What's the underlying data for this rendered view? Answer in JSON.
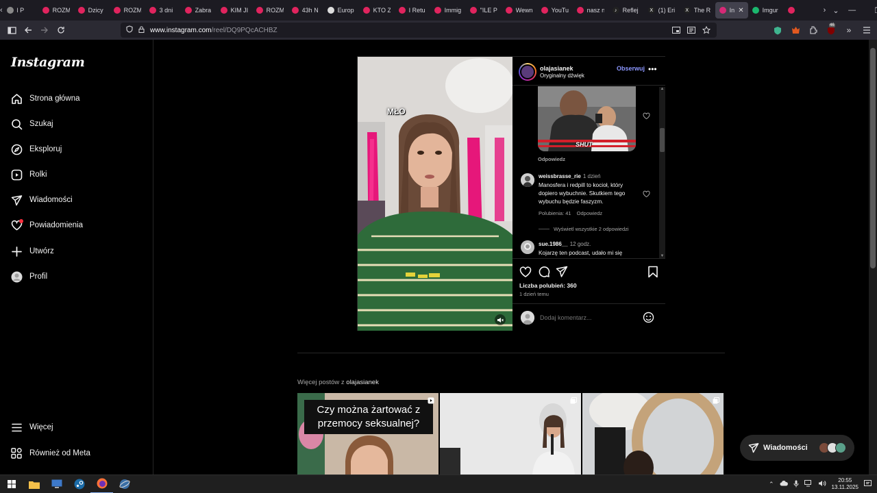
{
  "browser": {
    "tabs": [
      {
        "label": "l P",
        "color": "#888888",
        "glyph": ""
      },
      {
        "label": "ROZM",
        "color": "#e0245e",
        "glyph": ""
      },
      {
        "label": "Dzicy",
        "color": "#e0245e",
        "glyph": ""
      },
      {
        "label": "ROZM",
        "color": "#e0245e",
        "glyph": ""
      },
      {
        "label": "3 dni",
        "color": "#e0245e",
        "glyph": ""
      },
      {
        "label": "Zabra",
        "color": "#e0245e",
        "glyph": ""
      },
      {
        "label": "KIM JI",
        "color": "#e0245e",
        "glyph": ""
      },
      {
        "label": "ROZM",
        "color": "#e0245e",
        "glyph": ""
      },
      {
        "label": "43h N",
        "color": "#e0245e",
        "glyph": ""
      },
      {
        "label": "Europ",
        "color": "#dddddd",
        "glyph": ""
      },
      {
        "label": "KTO Z",
        "color": "#e0245e",
        "glyph": ""
      },
      {
        "label": "I Retu",
        "color": "#e0245e",
        "glyph": ""
      },
      {
        "label": "Immig",
        "color": "#e0245e",
        "glyph": ""
      },
      {
        "label": "\"ILE P",
        "color": "#e0245e",
        "glyph": ""
      },
      {
        "label": "Wewn",
        "color": "#e0245e",
        "glyph": ""
      },
      {
        "label": "YouTu",
        "color": "#e0245e",
        "glyph": ""
      },
      {
        "label": "nasz n",
        "color": "#e0245e",
        "glyph": ""
      },
      {
        "label": "Reflej",
        "color": "#222222",
        "glyph": "♪"
      },
      {
        "label": "(1) Eri",
        "color": "#222222",
        "glyph": "X"
      },
      {
        "label": "The R",
        "color": "#222222",
        "glyph": "X"
      },
      {
        "label": "Inst",
        "color": "#d62976",
        "glyph": "",
        "active": true
      },
      {
        "label": "Imgur",
        "color": "#1bb76e",
        "glyph": ""
      },
      {
        "label": "",
        "color": "#e0245e",
        "glyph": ""
      }
    ],
    "url_host": "www.instagram.com",
    "url_path": "/reel/DQ9PQcACHBZ",
    "badge_count": "46"
  },
  "sidebar": {
    "logo": "Instagram",
    "items": [
      {
        "label": "Strona główna",
        "icon": "home-icon"
      },
      {
        "label": "Szukaj",
        "icon": "search-icon"
      },
      {
        "label": "Eksploruj",
        "icon": "compass-icon"
      },
      {
        "label": "Rolki",
        "icon": "reels-icon"
      },
      {
        "label": "Wiadomości",
        "icon": "messages-icon"
      },
      {
        "label": "Powiadomienia",
        "icon": "heart-icon"
      },
      {
        "label": "Utwórz",
        "icon": "plus-icon"
      },
      {
        "label": "Profil",
        "icon": "profile-avatar"
      }
    ],
    "bottom": [
      {
        "label": "Więcej",
        "icon": "menu-icon"
      },
      {
        "label": "Również od Meta",
        "icon": "meta-icon"
      }
    ]
  },
  "post": {
    "video_overlay_text": "MŁO",
    "username": "olajasianek",
    "audio": "Oryginalny dźwięk",
    "follow_label": "Obserwuj",
    "meme_caption": "SHUT",
    "reply_label": "Odpowiedz",
    "comments": [
      {
        "user": "weissbrasse_rie",
        "time": "1 dzień",
        "text": "Manosfera i redpill to kocioł, który dopiero wybuchnie. Skutkiem tego wybuchu będzie faszyzm.",
        "likes": "Polubienia: 41",
        "reply": "Odpowiedz"
      },
      {
        "user": "sue.1986__",
        "time": "12 godz.",
        "text": "Kojarzę ten podcast, udało mi się"
      }
    ],
    "view_replies": "Wyświetl wszystkie 2 odpowiedzi",
    "likes_count": "Liczba polubień: 360",
    "posted_ago": "1 dzień temu",
    "add_comment_placeholder": "Dodaj komentarz..."
  },
  "more_posts": {
    "label_prefix": "Więcej postów z ",
    "label_user": "olajasianek",
    "first_caption": "Czy można żartować z przemocy seksualnej?"
  },
  "messages_pill": {
    "label": "Wiadomości"
  },
  "taskbar": {
    "time": "20:55",
    "date": "13.11.2025"
  }
}
